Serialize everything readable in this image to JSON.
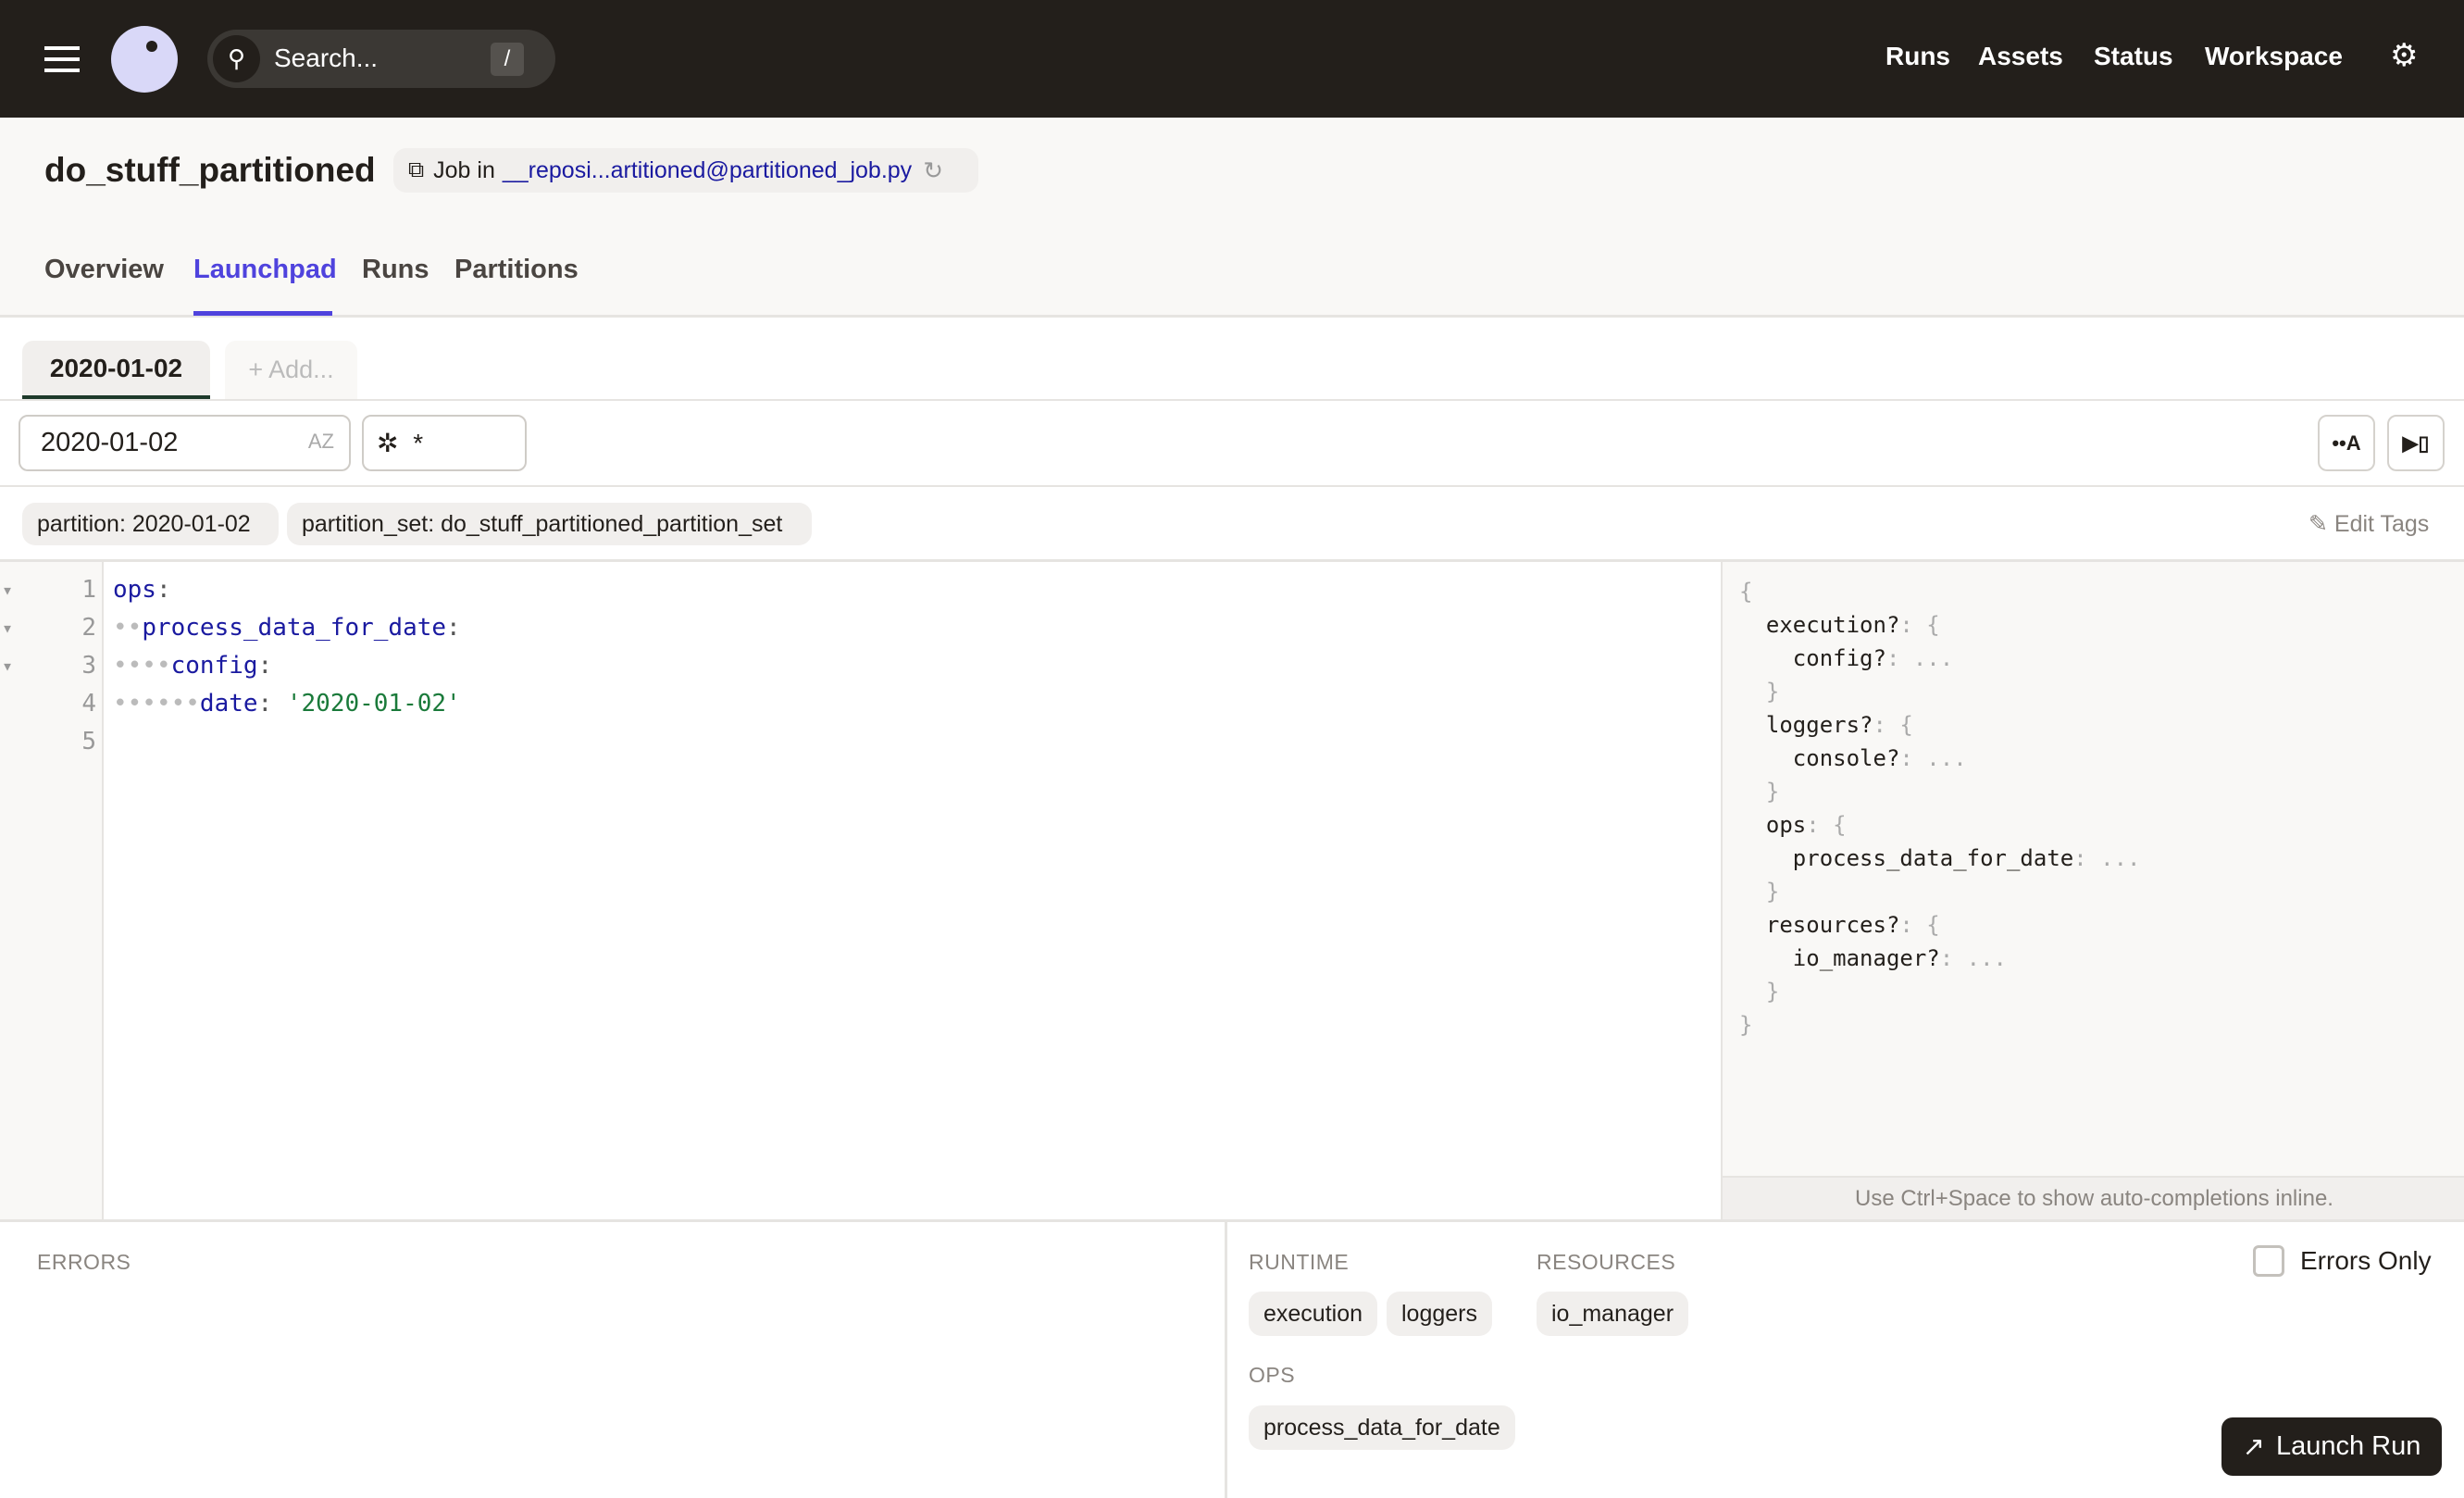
{
  "header": {
    "search_placeholder": "Search...",
    "search_shortcut": "/",
    "nav": [
      "Runs",
      "Assets",
      "Status",
      "Workspace"
    ]
  },
  "job": {
    "title": "do_stuff_partitioned",
    "job_in_label": "Job in",
    "repo_link": "__reposi...artitioned@partitioned_job.py"
  },
  "tabs": [
    "Overview",
    "Launchpad",
    "Runs",
    "Partitions"
  ],
  "active_tab": "Launchpad",
  "session_tabs": {
    "active": "2020-01-02",
    "add": "+ Add..."
  },
  "partition_input": {
    "value": "2020-01-02"
  },
  "op_selector": {
    "value": "*"
  },
  "tags": [
    "partition: 2020-01-02",
    "partition_set: do_stuff_partitioned_partition_set"
  ],
  "edit_tags": "Edit Tags",
  "editor": {
    "lines": [
      {
        "n": "1",
        "indent": "",
        "key": "ops",
        "rest": ":"
      },
      {
        "n": "2",
        "indent": "••",
        "key": "process_data_for_date",
        "rest": ":"
      },
      {
        "n": "3",
        "indent": "••••",
        "key": "config",
        "rest": ":"
      },
      {
        "n": "4",
        "indent": "••••••",
        "key": "date",
        "rest": ": ",
        "val": "'2020-01-02'"
      },
      {
        "n": "5",
        "indent": "",
        "key": "",
        "rest": ""
      }
    ]
  },
  "schema": {
    "lines": [
      [
        "",
        "{",
        ""
      ],
      [
        "  execution?",
        ": {",
        ""
      ],
      [
        "    config?",
        ": ...",
        ""
      ],
      [
        "  ",
        "}",
        ""
      ],
      [
        "  loggers?",
        ": {",
        ""
      ],
      [
        "    console?",
        ": ...",
        ""
      ],
      [
        "  ",
        "}",
        ""
      ],
      [
        "  ops",
        ": {",
        ""
      ],
      [
        "    process_data_for_date",
        ": ...",
        ""
      ],
      [
        "  ",
        "}",
        ""
      ],
      [
        "  resources?",
        ": {",
        ""
      ],
      [
        "    io_manager?",
        ": ...",
        ""
      ],
      [
        "  ",
        "}",
        ""
      ],
      [
        "",
        "}",
        ""
      ]
    ],
    "hint": "Use Ctrl+Space to show auto-completions inline."
  },
  "bottom": {
    "errors_label": "ERRORS",
    "runtime_label": "RUNTIME",
    "runtime_items": [
      "execution",
      "loggers"
    ],
    "resources_label": "RESOURCES",
    "resources_items": [
      "io_manager"
    ],
    "ops_label": "OPS",
    "ops_items": [
      "process_data_for_date"
    ],
    "errors_only": "Errors Only",
    "launch": "Launch Run"
  },
  "colors": {
    "header_bg": "#231f1b",
    "accent": "#4f43dd",
    "link": "#1a1aa0",
    "string": "#1a7a3a",
    "key": "#1a1aa0"
  }
}
